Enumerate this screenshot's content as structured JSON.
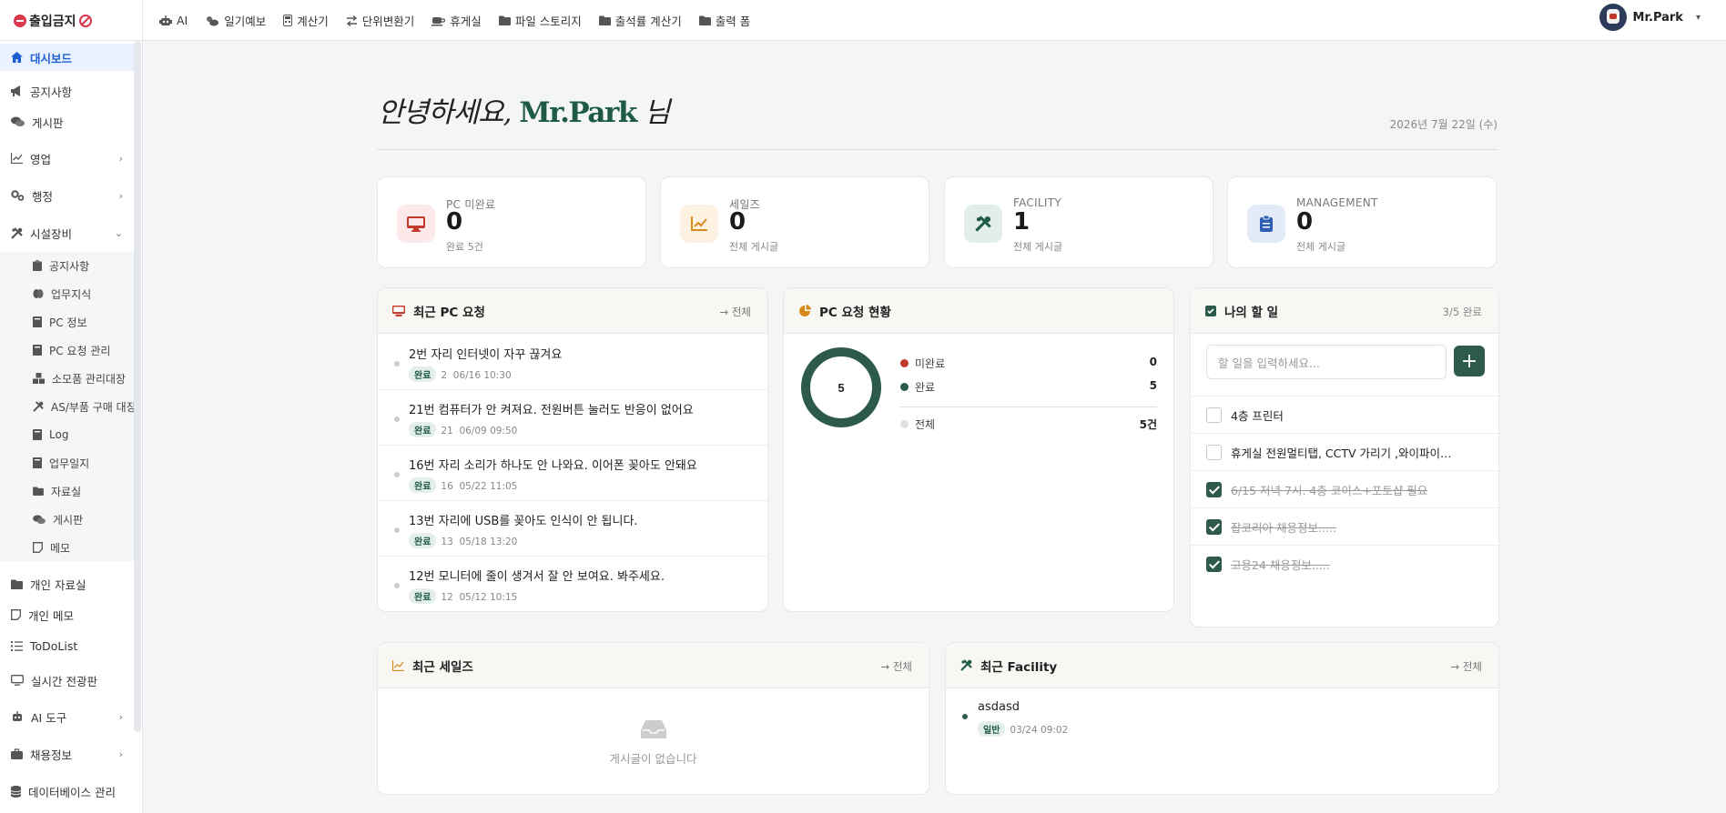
{
  "brand": {
    "name": "출입금지"
  },
  "topnav": [
    {
      "label": "AI",
      "icon": "robot-icon"
    },
    {
      "label": "일기예보",
      "icon": "cloud-sun-icon"
    },
    {
      "label": "계산기",
      "icon": "calculator-icon"
    },
    {
      "label": "단위변환기",
      "icon": "swap-arrows-icon"
    },
    {
      "label": "휴게실",
      "icon": "coffee-cup-icon"
    },
    {
      "label": "파일 스토리지",
      "icon": "folder-icon"
    },
    {
      "label": "출석률 계산기",
      "icon": "folder-icon"
    },
    {
      "label": "출력 폼",
      "icon": "folder-icon"
    }
  ],
  "user": {
    "name": "Mr.Park"
  },
  "sidebar": {
    "items": [
      {
        "label": "대시보드",
        "icon": "home-icon",
        "active": true
      },
      {
        "label": "공지사항",
        "icon": "megaphone-icon"
      },
      {
        "label": "게시판",
        "icon": "comments-icon"
      },
      {
        "label": "영업",
        "icon": "line-chart-icon",
        "expandable": true
      },
      {
        "label": "행정",
        "icon": "gears-icon",
        "expandable": true
      },
      {
        "label": "시설장비",
        "icon": "tools-icon",
        "expanded": true
      },
      {
        "label": "개인 자료실",
        "icon": "folder-icon"
      },
      {
        "label": "개인 메모",
        "icon": "note-icon"
      },
      {
        "label": "ToDoList",
        "icon": "list-check-icon"
      },
      {
        "label": "실시간 전광판",
        "icon": "monitor-icon"
      },
      {
        "label": "AI 도구",
        "icon": "robot-icon",
        "expandable": true
      },
      {
        "label": "채용정보",
        "icon": "briefcase-icon",
        "expandable": true
      },
      {
        "label": "데이터베이스 관리",
        "icon": "database-icon"
      }
    ],
    "subitems": [
      {
        "label": "공지사항",
        "icon": "clipboard-icon"
      },
      {
        "label": "업무지식",
        "icon": "brain-icon"
      },
      {
        "label": "PC 정보",
        "icon": "book-icon"
      },
      {
        "label": "PC 요청 관리",
        "icon": "book-icon"
      },
      {
        "label": "소모품 관리대장",
        "icon": "boxes-icon"
      },
      {
        "label": "AS/부품 구매 대장",
        "icon": "tools-icon"
      },
      {
        "label": "Log",
        "icon": "book-icon"
      },
      {
        "label": "업무일지",
        "icon": "book-icon"
      },
      {
        "label": "자료실",
        "icon": "folder-icon"
      },
      {
        "label": "게시판",
        "icon": "comments-icon"
      },
      {
        "label": "메모",
        "icon": "note-icon"
      }
    ]
  },
  "header": {
    "greeting_pre": "안녕하세요,",
    "greeting_name": "Mr.Park",
    "greeting_post": "님",
    "date": "2026년 7월 22일 (수)"
  },
  "stats": [
    {
      "label": "PC 미완료",
      "value": "0",
      "sub": "완료 5건",
      "icon": "desktop-icon",
      "bg": "#fde8ea",
      "fg": "#c0392b"
    },
    {
      "label": "세일즈",
      "value": "0",
      "sub": "전체 게시글",
      "icon": "line-chart-icon",
      "bg": "#fdf1e1",
      "fg": "#d98a1c"
    },
    {
      "label": "FACILITY",
      "value": "1",
      "sub": "전체 게시글",
      "icon": "tools-icon",
      "bg": "#e2efe9",
      "fg": "#1f5a46"
    },
    {
      "label": "MANAGEMENT",
      "value": "0",
      "sub": "전체 게시글",
      "icon": "clipboard-list-icon",
      "bg": "#e4ebf8",
      "fg": "#2f5fb3"
    }
  ],
  "pc_requests": {
    "title": "최근 PC 요청",
    "link": "전체",
    "items": [
      {
        "title": "2번 자리 인터넷이 자꾸 끊겨요",
        "status": "완료",
        "seat": "2",
        "date": "06/16 10:30"
      },
      {
        "title": "21번 컴퓨터가 안 켜져요. 전원버튼 눌러도 반응이 없어요",
        "status": "완료",
        "seat": "21",
        "date": "06/09 09:50"
      },
      {
        "title": "16번 자리 소리가 하나도 안 나와요. 이어폰 꽂아도 안돼요",
        "status": "완료",
        "seat": "16",
        "date": "05/22 11:05"
      },
      {
        "title": "13번 자리에 USB를 꽂아도 인식이 안 됩니다.",
        "status": "완료",
        "seat": "13",
        "date": "05/18 13:20"
      },
      {
        "title": "12번 모니터에 줄이 생겨서 잘 안 보여요. 봐주세요.",
        "status": "완료",
        "seat": "12",
        "date": "05/12 10:15"
      }
    ]
  },
  "pc_status": {
    "title": "PC 요청 현황",
    "center": "5",
    "legend": [
      {
        "label": "미완료",
        "value": "0",
        "color": "#c0392b"
      },
      {
        "label": "완료",
        "value": "5",
        "color": "#2d5a4a"
      }
    ],
    "total_label": "전체",
    "total_value": "5건"
  },
  "chart_data": {
    "type": "pie",
    "title": "PC 요청 현황",
    "categories": [
      "미완료",
      "완료"
    ],
    "values": [
      0,
      5
    ],
    "colors": [
      "#c0392b",
      "#2d5a4a"
    ]
  },
  "todo": {
    "title": "나의 할 일",
    "progress": "3/5 완료",
    "placeholder": "할 일을 입력하세요...",
    "items": [
      {
        "text": "4층 프린터",
        "done": false
      },
      {
        "text": "휴게실 전원멀티탭, CCTV 가리기 ,와이파이…",
        "done": false
      },
      {
        "text": "6/15 저녁 7시. 4층 코이스+포토샵 필요",
        "done": true
      },
      {
        "text": "잡코리아 채용정보.....",
        "done": true
      },
      {
        "text": "고용24 채용정보.....",
        "done": true
      }
    ]
  },
  "sales": {
    "title": "최근 세일즈",
    "link": "전체",
    "empty": "게시글이 없습니다"
  },
  "facility": {
    "title": "최근 Facility",
    "link": "전체",
    "items": [
      {
        "title": "asdasd",
        "badge": "일반",
        "date": "03/24 09:02"
      }
    ]
  }
}
